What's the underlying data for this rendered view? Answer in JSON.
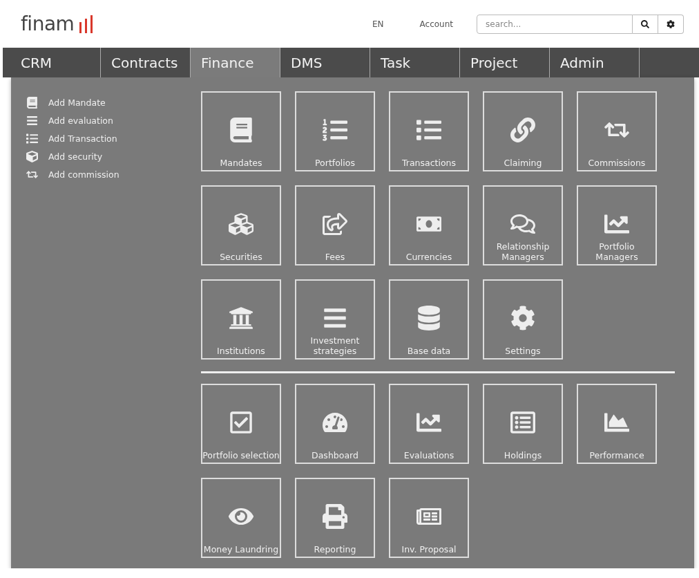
{
  "header": {
    "logo": "finam",
    "language": "EN",
    "account": "Account",
    "search": {
      "placeholder": "search..."
    }
  },
  "tabs": [
    {
      "label": "CRM",
      "selected": false
    },
    {
      "label": "Contracts",
      "selected": false
    },
    {
      "label": "Finance",
      "selected": true
    },
    {
      "label": "DMS",
      "selected": false
    },
    {
      "label": "Task",
      "selected": false
    },
    {
      "label": "Project",
      "selected": false
    },
    {
      "label": "Admin",
      "selected": false
    }
  ],
  "sidebar": {
    "items": [
      {
        "label": "Add Mandate"
      },
      {
        "label": "Add evaluation"
      },
      {
        "label": "Add Transaction"
      },
      {
        "label": "Add security"
      },
      {
        "label": "Add commission"
      }
    ]
  },
  "sections": [
    {
      "tiles": [
        {
          "label": "Mandates"
        },
        {
          "label": "Portfolios"
        },
        {
          "label": "Transactions"
        },
        {
          "label": "Claiming"
        },
        {
          "label": "Commissions"
        },
        {
          "label": "Securities"
        },
        {
          "label": "Fees"
        },
        {
          "label": "Currencies"
        },
        {
          "label": "Relationship Managers"
        },
        {
          "label": "Portfolio Managers"
        },
        {
          "label": "Institutions"
        },
        {
          "label": "Investment strategies"
        },
        {
          "label": "Base data"
        },
        {
          "label": "Settings"
        }
      ]
    },
    {
      "tiles": [
        {
          "label": "Portfolio selection"
        },
        {
          "label": "Dashboard"
        },
        {
          "label": "Evaluations"
        },
        {
          "label": "Holdings"
        },
        {
          "label": "Performance"
        },
        {
          "label": "Money Laundring"
        },
        {
          "label": "Reporting"
        },
        {
          "label": "Inv. Proposal"
        }
      ]
    }
  ]
}
